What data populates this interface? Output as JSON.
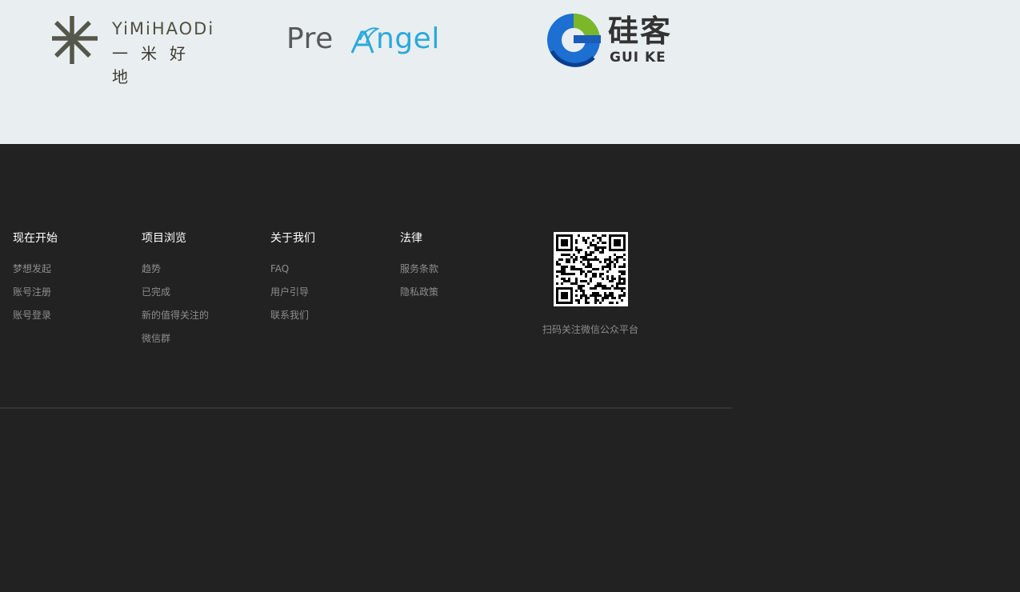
{
  "partners": {
    "yimi": {
      "en": "YiMiHAODi",
      "cn": "一米好地",
      "color": "#4e5040"
    },
    "preangel": {
      "pre": "Pre",
      "angel": "ngel",
      "pre_color": "#575a5c",
      "angel_color": "#29a9dc"
    },
    "guike": {
      "cn": "硅客",
      "en": "GUI KE",
      "colors": [
        "#7ab829",
        "#1f6fd0",
        "#0a3e8e"
      ]
    }
  },
  "footer": {
    "col1": {
      "title": "现在开始",
      "links": [
        "梦想发起",
        "账号注册",
        "账号登录"
      ]
    },
    "col2": {
      "title": "项目浏览",
      "links": [
        "趋势",
        "已完成",
        "新的值得关注的",
        "微信群"
      ]
    },
    "col3": {
      "title": "关于我们",
      "links": [
        "FAQ",
        "用户引导",
        "联系我们"
      ]
    },
    "col4": {
      "title": "法律",
      "links": [
        "服务条款",
        "隐私政策"
      ]
    },
    "qr": {
      "caption": "扫码关注微信公众平台",
      "icon": "qr-code-icon"
    }
  },
  "colors": {
    "partner_bg": "#e9eef0",
    "footer_bg": "#222222",
    "link": "#8d8d8d",
    "title": "#ffffff"
  }
}
